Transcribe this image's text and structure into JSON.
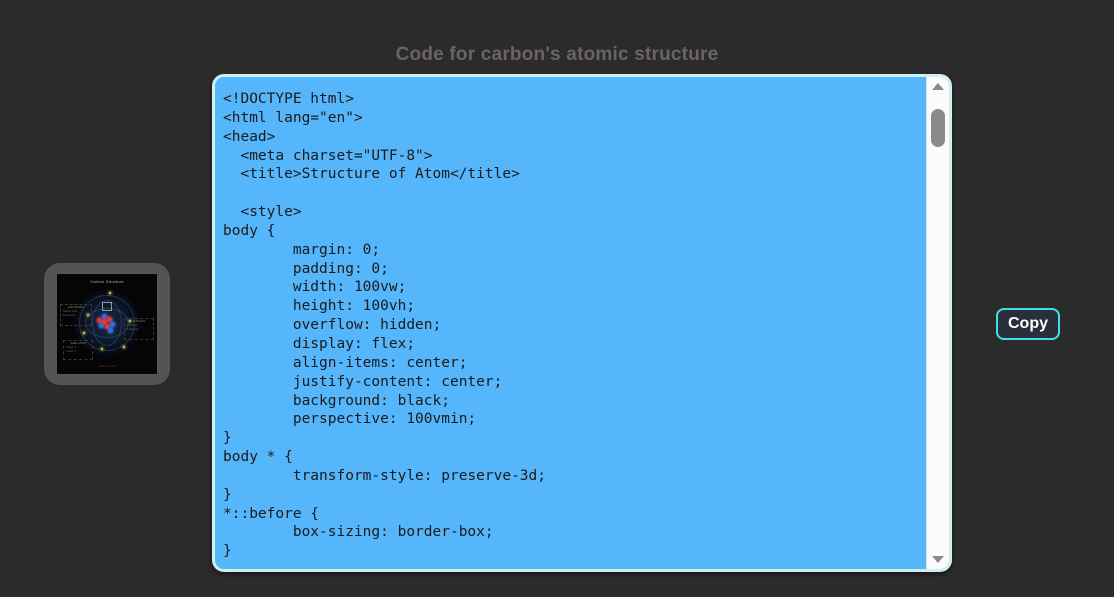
{
  "page": {
    "title": "Code for carbon's atomic structure",
    "background_color": "#2b2b2b",
    "title_color": "#6b6460"
  },
  "code_panel": {
    "background_color": "#55b6fb",
    "border_color": "#cfeff2",
    "text_color": "#1b1b1b",
    "content": "<!DOCTYPE html>\n<html lang=\"en\">\n<head>\n  <meta charset=\"UTF-8\">\n  <title>Structure of Atom</title>\n\n  <style>\nbody {\n        margin: 0;\n        padding: 0;\n        width: 100vw;\n        height: 100vh;\n        overflow: hidden;\n        display: flex;\n        align-items: center;\n        justify-content: center;\n        background: black;\n        perspective: 100vmin;\n}\nbody * {\n        transform-style: preserve-3d;\n}\n*::before {\n        box-sizing: border-box;\n}"
  },
  "scrollbar": {
    "up_arrow": "scroll-up",
    "down_arrow": "scroll-down",
    "thumb_color": "#8b8b8b",
    "track_color": "#fbfbfb"
  },
  "copy_button": {
    "label": "Copy",
    "border_color": "#3fe0e0",
    "background_color": "#2a2d3a",
    "text_color": "#ffffff"
  },
  "preview": {
    "frame_color": "#555453",
    "screen_color": "#050507",
    "heading": "Carbon Structure",
    "footnote": "Carbon Atom",
    "legends": [
      {
        "id": "left-top",
        "title": "ELECTRONS",
        "rows": [
          "Valence shell",
          "2 electrons"
        ]
      },
      {
        "id": "left-bottom",
        "title": "SHELL DATA",
        "rows": [
          "K shell : 2",
          "L shell : 4"
        ]
      },
      {
        "id": "right",
        "title": "NUCLEUS",
        "rows": [
          "6 protons",
          "6 neutrons"
        ]
      }
    ],
    "nucleus": {
      "proton_color": "#e03a3a",
      "neutron_color": "#2f6fe0",
      "protons": 6,
      "neutrons": 6
    },
    "electron_color": "#d8d45a"
  }
}
